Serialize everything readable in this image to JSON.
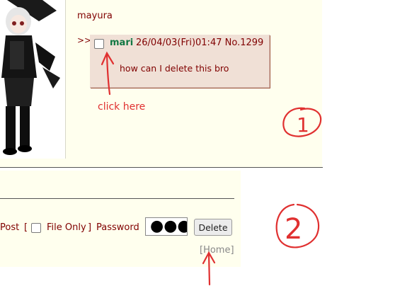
{
  "thread": {
    "op_name": "mayura",
    "reply": {
      "arrows": ">>",
      "name": "mari",
      "datetime": "26/04/03(Fri)01:47",
      "number": "No.1299",
      "comment": "how can I delete this bro"
    }
  },
  "annotations": {
    "arrow_label": "click here",
    "step1": "1",
    "step2": "2",
    "color": "#e03030"
  },
  "delete_form": {
    "post_text": "Post",
    "bracket_open": "[",
    "file_only_label": "File Only",
    "bracket_close": "]",
    "password_label": "Password",
    "password_value": "●●●●",
    "delete_button": "Delete"
  },
  "footer": {
    "home_link": "[Home]"
  }
}
